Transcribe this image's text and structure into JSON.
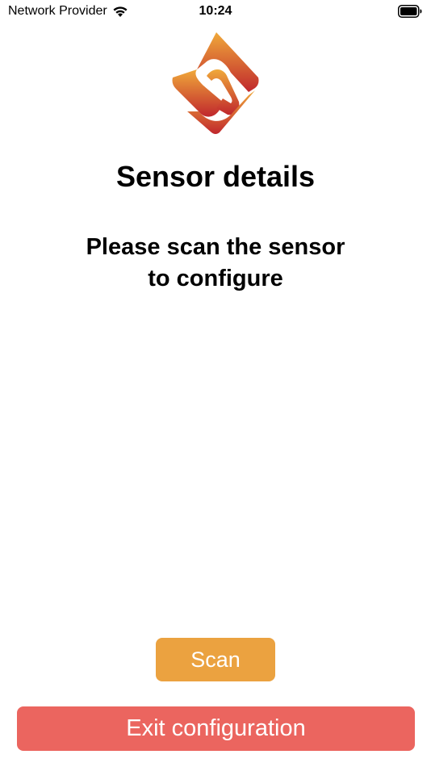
{
  "status_bar": {
    "carrier": "Network Provider",
    "time": "10:24",
    "icons": [
      "wifi-icon",
      "battery-icon"
    ]
  },
  "logo": {
    "icon": "brand-logo",
    "colors": {
      "top": "#F0A93A",
      "bottom": "#C0272D"
    }
  },
  "main": {
    "title": "Sensor details",
    "instruction_line1": "Please scan the sensor",
    "instruction_line2": "to configure"
  },
  "actions": {
    "scan_label": "Scan",
    "exit_label": "Exit configuration"
  },
  "colors": {
    "scan_button": "#EBA240",
    "exit_button": "#EB655F",
    "button_text": "#FFFFFF",
    "background": "#FFFFFF"
  }
}
